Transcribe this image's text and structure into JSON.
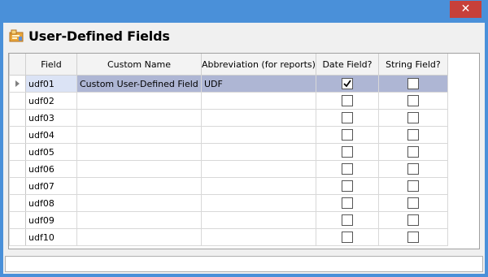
{
  "window": {
    "close_glyph": "✕"
  },
  "header": {
    "title": "User-Defined Fields",
    "icon": "udf-app-icon"
  },
  "grid": {
    "columns": [
      {
        "label": "Field"
      },
      {
        "label": "Custom Name"
      },
      {
        "label": "Abbreviation (for reports)"
      },
      {
        "label": "Date Field?"
      },
      {
        "label": "String Field?"
      }
    ],
    "rows": [
      {
        "field": "udf01",
        "custom_name": "Custom User-Defined Field",
        "abbreviation": "UDF",
        "date_field": true,
        "string_field": false,
        "selected": true
      },
      {
        "field": "udf02",
        "custom_name": "",
        "abbreviation": "",
        "date_field": false,
        "string_field": false
      },
      {
        "field": "udf03",
        "custom_name": "",
        "abbreviation": "",
        "date_field": false,
        "string_field": false
      },
      {
        "field": "udf04",
        "custom_name": "",
        "abbreviation": "",
        "date_field": false,
        "string_field": false
      },
      {
        "field": "udf05",
        "custom_name": "",
        "abbreviation": "",
        "date_field": false,
        "string_field": false
      },
      {
        "field": "udf06",
        "custom_name": "",
        "abbreviation": "",
        "date_field": false,
        "string_field": false
      },
      {
        "field": "udf07",
        "custom_name": "",
        "abbreviation": "",
        "date_field": false,
        "string_field": false
      },
      {
        "field": "udf08",
        "custom_name": "",
        "abbreviation": "",
        "date_field": false,
        "string_field": false
      },
      {
        "field": "udf09",
        "custom_name": "",
        "abbreviation": "",
        "date_field": false,
        "string_field": false
      },
      {
        "field": "udf10",
        "custom_name": "",
        "abbreviation": "",
        "date_field": false,
        "string_field": false
      }
    ]
  },
  "colors": {
    "titlebar": "#4a90d9",
    "close": "#c7403a",
    "selected_row": "#aeb6d4"
  }
}
